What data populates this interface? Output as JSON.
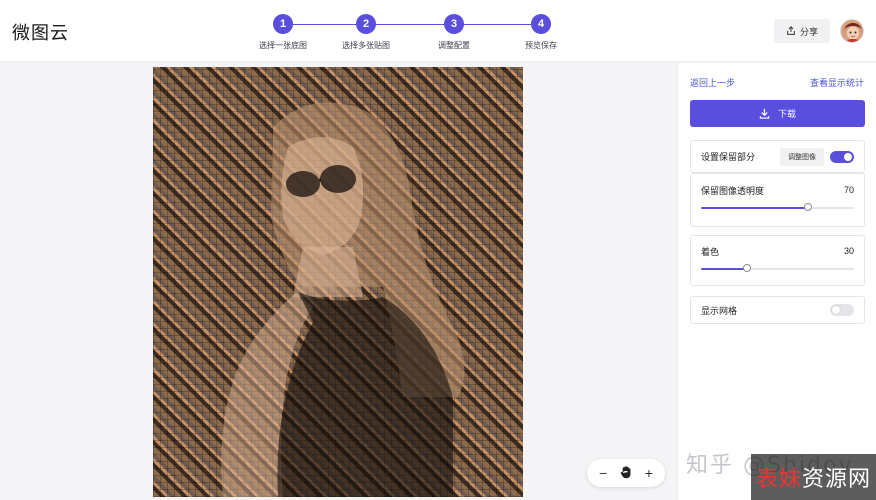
{
  "app": {
    "logo": "微图云"
  },
  "steps": [
    {
      "num": "1",
      "label": "选择一张底图"
    },
    {
      "num": "2",
      "label": "选择多张贴图"
    },
    {
      "num": "3",
      "label": "调整配置"
    },
    {
      "num": "4",
      "label": "预览保存"
    }
  ],
  "header": {
    "share_label": "分享"
  },
  "panel": {
    "back_label": "返回上一步",
    "stats_label": "查看显示统计",
    "download_label": "下载",
    "keep_part": {
      "title": "设置保留部分",
      "button": "调整图像",
      "enabled": true
    },
    "opacity": {
      "title": "保留图像透明度",
      "value": "70",
      "level": 0.7
    },
    "tint": {
      "title": "着色",
      "value": "30",
      "level": 0.3
    },
    "grid": {
      "title": "显示网格",
      "enabled": false
    }
  },
  "zoom": {
    "minus": "−",
    "plus": "+"
  },
  "watermark": {
    "zhihu": "知乎 @Shidoy",
    "site_a": "表妹",
    "site_b": "资源网"
  },
  "colors": {
    "accent": "#5a4fdc",
    "link": "#4a52d8"
  }
}
